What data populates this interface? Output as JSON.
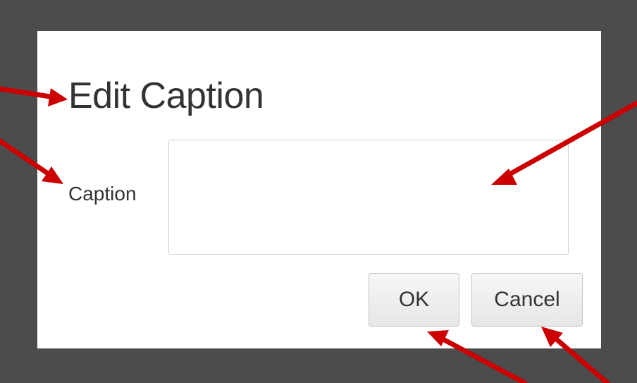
{
  "dialog": {
    "title": "Edit Caption",
    "caption_label": "Caption",
    "caption_value": "",
    "ok_label": "OK",
    "cancel_label": "Cancel"
  },
  "colors": {
    "backdrop": "#4a4a4a",
    "dialog_background": "#ffffff",
    "annotation_arrow": "#cc0000"
  }
}
